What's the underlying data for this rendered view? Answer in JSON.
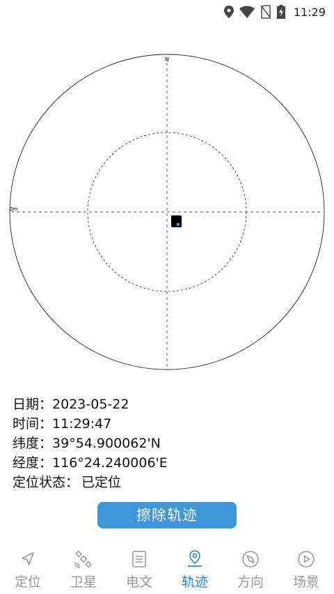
{
  "status_bar": {
    "time": "11:29",
    "icons": [
      "location-icon",
      "wifi-icon",
      "no-sim-icon",
      "battery-charging-icon"
    ]
  },
  "radar": {
    "north_label": "N",
    "scale_label": "2m"
  },
  "info": {
    "date_label": "日期：",
    "date_value": "2023-05-22",
    "time_label": "时间：",
    "time_value": "11:29:47",
    "lat_label": "纬度：",
    "lat_value": "39°54.900062'N",
    "lon_label": "经度：",
    "lon_value": "116°24.240006'E",
    "status_label": "定位状态：",
    "status_value": "已定位"
  },
  "clear_button": {
    "label": "擦除轨迹"
  },
  "tabs": [
    {
      "label": "定位",
      "icon": "navigation-arrow-icon",
      "active": false
    },
    {
      "label": "卫星",
      "icon": "satellite-icon",
      "active": false
    },
    {
      "label": "电文",
      "icon": "document-icon",
      "active": false
    },
    {
      "label": "轨迹",
      "icon": "map-pin-icon",
      "active": true
    },
    {
      "label": "方向",
      "icon": "compass-icon",
      "active": false
    },
    {
      "label": "场景",
      "icon": "play-circle-icon",
      "active": false
    }
  ],
  "colors": {
    "accent": "#2a86c9",
    "button": "#3d96d7",
    "inactive": "#999999"
  }
}
